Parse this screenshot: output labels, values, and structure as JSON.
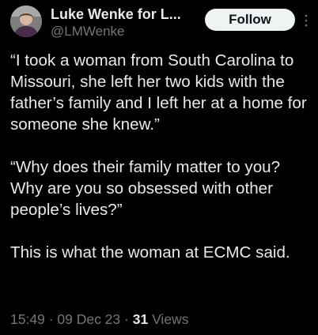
{
  "author": {
    "display_name": "Luke Wenke for L...",
    "handle": "@LMWenke"
  },
  "actions": {
    "follow_label": "Follow",
    "more_icon": "more-vertical-icon"
  },
  "tweet": {
    "paragraphs": [
      "“I took a woman from South Carolina to Missouri, she left her two kids with the father’s family and I left her at a home for someone she knew.”",
      "“Why does their family matter to you?  Why are you so obsessed with other people’s lives?”",
      "This is what the woman at ECMC said."
    ]
  },
  "meta": {
    "time": "15:49",
    "separator": "·",
    "date": "09 Dec 23",
    "views_count": "31",
    "views_label": "Views"
  },
  "colors": {
    "background": "#000000",
    "text_primary": "#e7e9ea",
    "text_secondary": "#71767b",
    "follow_bg": "#eff3f4"
  }
}
